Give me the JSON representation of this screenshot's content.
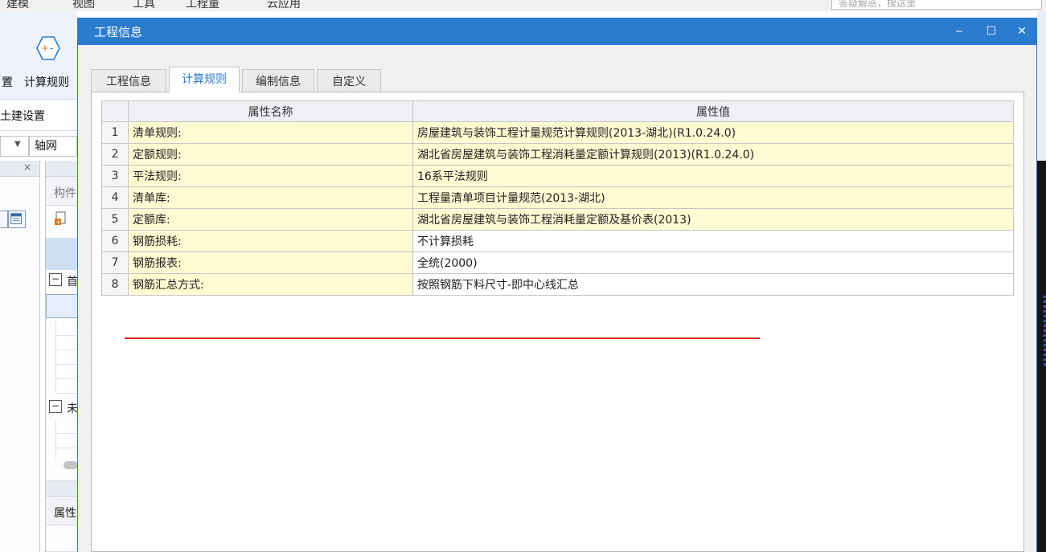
{
  "app": {
    "menu": [
      "建模",
      "视图",
      "工具",
      "工程量",
      "云应用"
    ],
    "search_placeholder": "答疑解惑，搜这里",
    "ribbon": {
      "settings_label_partial": "置",
      "calc_rule_label": "计算规则",
      "group_label": "土建设置"
    },
    "combo_axis_value": "轴网",
    "panel_header_partial": "构件",
    "tree_node_1_partial": "首",
    "tree_node_2_partial": "未",
    "property_header_partial": "属性"
  },
  "dialog": {
    "title": "工程信息",
    "window_controls": {
      "minimize": "‒",
      "maximize": "☐",
      "close": "✕"
    },
    "tabs": [
      {
        "label": "工程信息",
        "active": false
      },
      {
        "label": "计算规则",
        "active": true
      },
      {
        "label": "编制信息",
        "active": false
      },
      {
        "label": "自定义",
        "active": false
      }
    ],
    "table": {
      "columns": [
        "属性名称",
        "属性值"
      ],
      "rows": [
        {
          "index": "1",
          "name": "清单规则:",
          "value": "房屋建筑与装饰工程计量规范计算规则(2013-湖北)(R1.0.24.0)",
          "highlight": true
        },
        {
          "index": "2",
          "name": "定额规则:",
          "value": "湖北省房屋建筑与装饰工程消耗量定额计算规则(2013)(R1.0.24.0)",
          "highlight": true
        },
        {
          "index": "3",
          "name": "平法规则:",
          "value": "16系平法规则",
          "highlight": true
        },
        {
          "index": "4",
          "name": "清单库:",
          "value": "工程量清单项目计量规范(2013-湖北)",
          "highlight": true
        },
        {
          "index": "5",
          "name": "定额库:",
          "value": "湖北省房屋建筑与装饰工程消耗量定额及基价表(2013)",
          "highlight": true
        },
        {
          "index": "6",
          "name": "钢筋损耗:",
          "value": "不计算损耗",
          "highlight": false
        },
        {
          "index": "7",
          "name": "钢筋报表:",
          "value": "全统(2000)",
          "highlight": false
        },
        {
          "index": "8",
          "name": "钢筋汇总方式:",
          "value": "按照钢筋下料尺寸-即中心线汇总",
          "highlight": false
        }
      ]
    },
    "annotation_color": "#e02020",
    "accent_color": "#2b7bd0"
  }
}
